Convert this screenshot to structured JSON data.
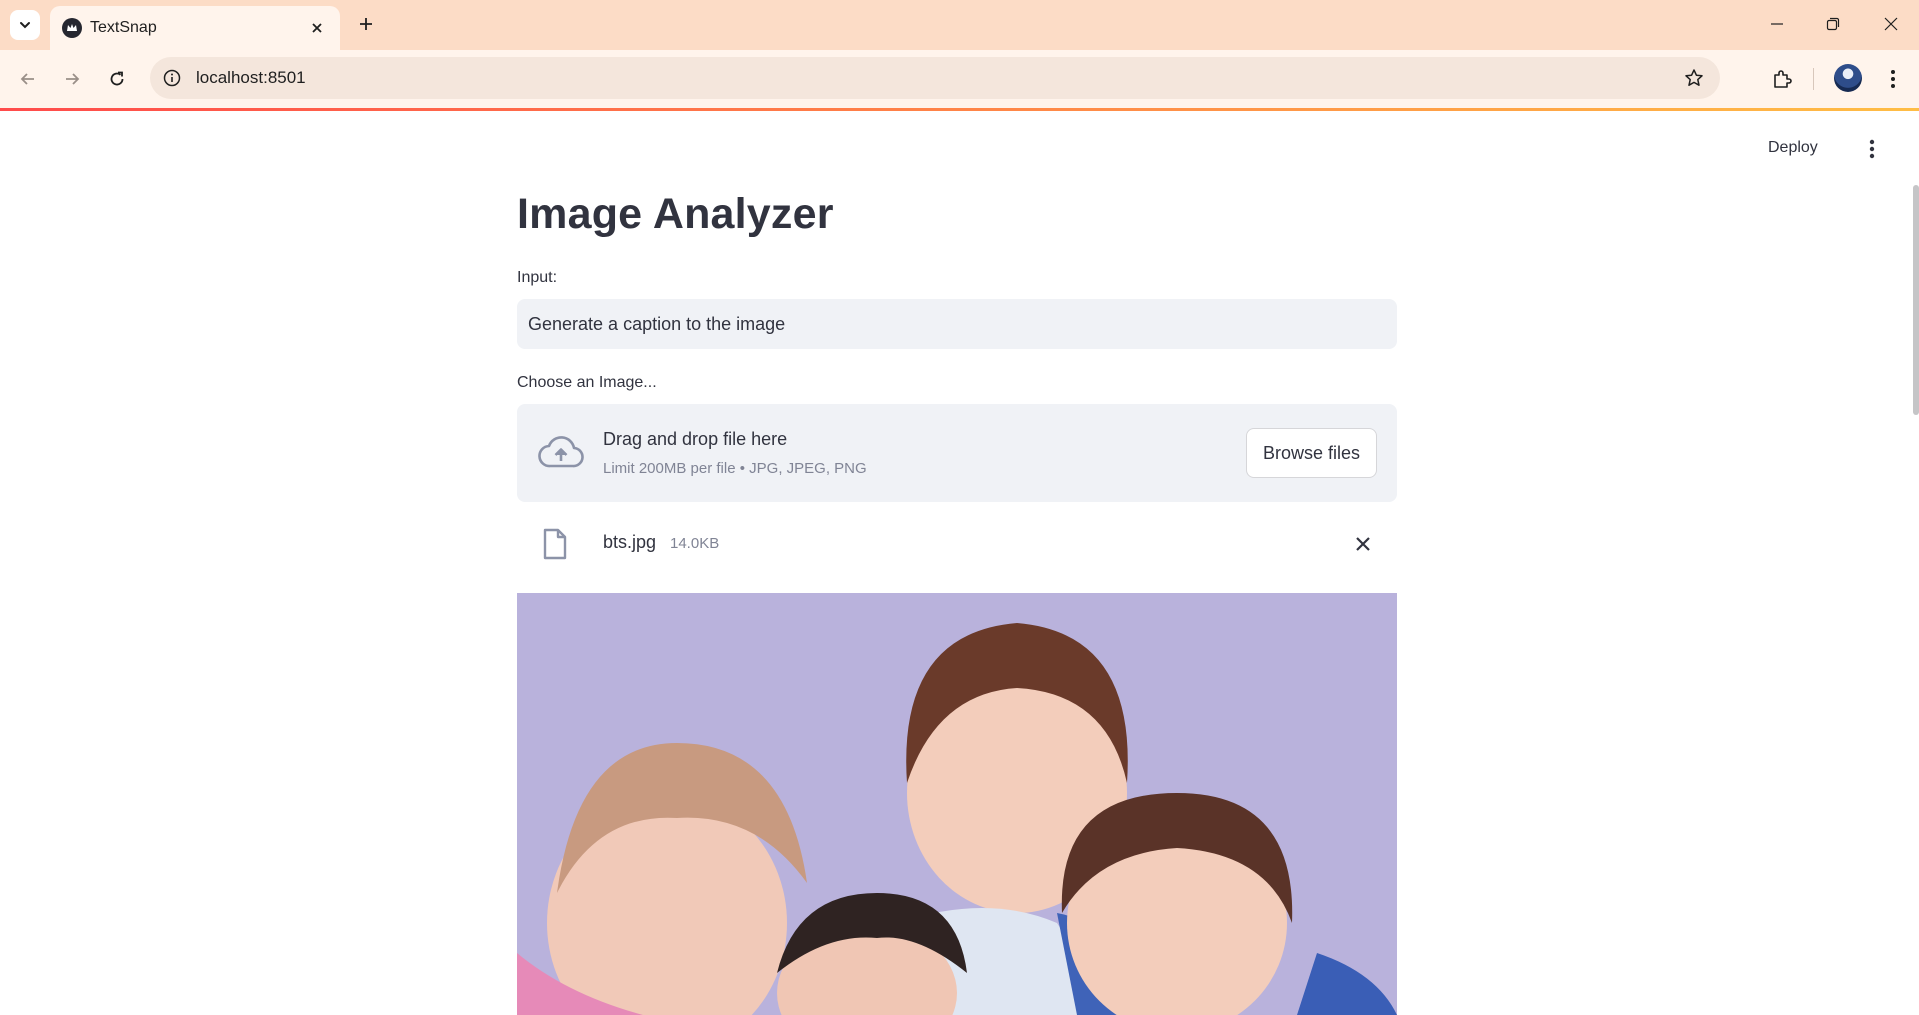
{
  "browser": {
    "tab_title": "TextSnap",
    "url": "localhost:8501",
    "colors": {
      "tabstrip": "#fcdcc6",
      "toolbar": "#fff4ec"
    }
  },
  "app": {
    "header": {
      "deploy_label": "Deploy"
    },
    "title": "Image Analyzer",
    "input": {
      "label": "Input:",
      "value": "Generate a caption to the image"
    },
    "uploader": {
      "label": "Choose an Image...",
      "drop_title": "Drag and drop file here",
      "limit_text": "Limit 200MB per file • JPG, JPEG, PNG",
      "browse_label": "Browse files"
    },
    "uploaded_file": {
      "name": "bts.jpg",
      "size": "14.0KB"
    },
    "colors": {
      "accent_gradient_start": "#ff4b4b",
      "accent_gradient_end": "#ffbd45",
      "text": "#31333f",
      "muted": "#808495",
      "widget_bg": "#f0f2f6"
    }
  }
}
